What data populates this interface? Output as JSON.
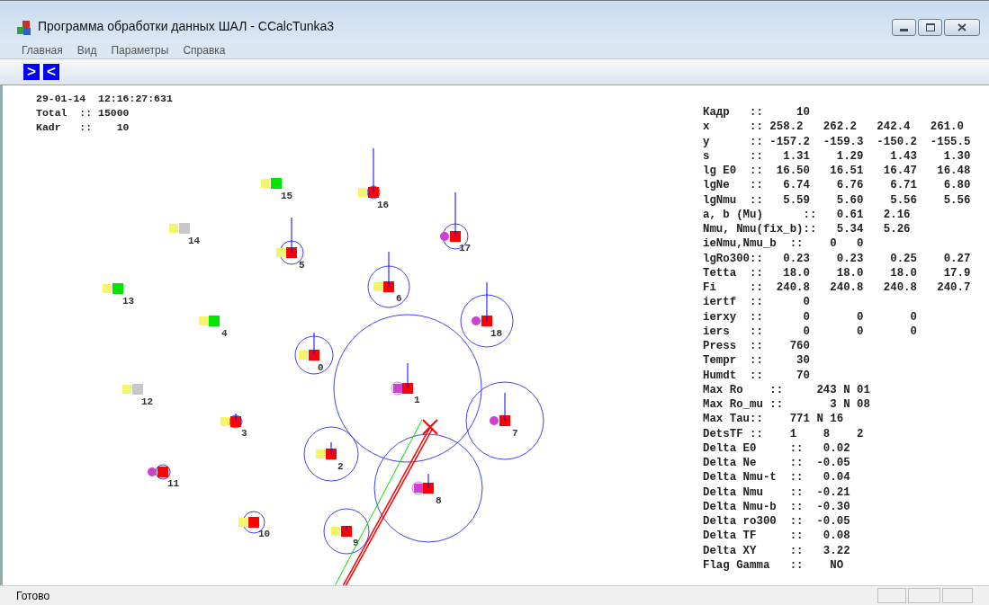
{
  "window": {
    "title": "Программа обработки данных ШАЛ - CCalcTunka3"
  },
  "menu": [
    {
      "label": "Главная"
    },
    {
      "label": "Вид"
    },
    {
      "label": "Параметры"
    },
    {
      "label": "Справка"
    }
  ],
  "toolbar": [
    {
      "label": ">"
    },
    {
      "label": "<"
    }
  ],
  "header_lines": [
    "29-01-14  12:16:27:631",
    "Total  :: 15000",
    "Kadr   ::    10"
  ],
  "detectors": [
    {
      "label": "0",
      "color": "#ff0000",
      "kind": "square"
    },
    {
      "label": "1",
      "color": "#ff0000",
      "kind": "ring"
    },
    {
      "label": "2",
      "color": "#ff0000",
      "kind": "square"
    },
    {
      "label": "3",
      "color": "#ff0000",
      "kind": "square"
    },
    {
      "label": "4",
      "color": "#00e600",
      "kind": "square"
    },
    {
      "label": "5",
      "color": "#ff0000",
      "kind": "square"
    },
    {
      "label": "6",
      "color": "#ff0000",
      "kind": "square"
    },
    {
      "label": "7",
      "color": "#ff0000",
      "kind": "dot"
    },
    {
      "label": "8",
      "color": "#ff0000",
      "kind": "ring"
    },
    {
      "label": "9",
      "color": "#ff0000",
      "kind": "square"
    },
    {
      "label": "10",
      "color": "#ff0000",
      "kind": "square"
    },
    {
      "label": "11",
      "color": "#ff0000",
      "kind": "dot"
    },
    {
      "label": "12",
      "color": "#c8c8c8",
      "kind": "square"
    },
    {
      "label": "13",
      "color": "#00e600",
      "kind": "square"
    },
    {
      "label": "14",
      "color": "#c8c8c8",
      "kind": "square"
    },
    {
      "label": "15",
      "color": "#00e600",
      "kind": "square"
    },
    {
      "label": "16",
      "color": "#ff0000",
      "kind": "square"
    },
    {
      "label": "17",
      "color": "#ff0000",
      "kind": "dot"
    },
    {
      "label": "18",
      "color": "#ff0000",
      "kind": "dot"
    }
  ],
  "readout": [
    "Кадр   ::     10",
    "x      :: 258.2   262.2   242.4   261.0",
    "y      :: -157.2  -159.3  -150.2  -155.5",
    "s      ::   1.31    1.29    1.43    1.30",
    "lg E0  ::  16.50   16.51   16.47   16.48",
    "lgNe   ::   6.74    6.76    6.71    6.80",
    "lgNmu  ::   5.59    5.60    5.56    5.56",
    "a, b (Mu)      ::   0.61   2.16",
    "Nmu, Nmu(fix_b)::   5.34   5.26",
    "ieNmu,Nmu_b  ::    0   0",
    "lgRo300::   0.23    0.23    0.25    0.27",
    "Tetta  ::   18.0    18.0    18.0    17.9",
    "Fi     ::  240.8   240.8   240.8   240.7",
    "iertf  ::      0",
    "ierxy  ::      0       0       0",
    "iers   ::      0       0       0",
    "Press  ::    760",
    "Tempr  ::     30",
    "Humdt  ::     70",
    "Max Ro    ::     243 N 01",
    "Max Ro_mu ::       3 N 08",
    "Max Tau::    771 N 16",
    "DetsTF ::    1    8    2",
    "Delta E0     ::   0.02",
    "Delta Ne     ::  -0.05",
    "Delta Nmu-t  ::   0.04",
    "Delta Nmu    ::  -0.21",
    "Delta Nmu-b  ::  -0.30",
    "Delta ro300  ::  -0.05",
    "Delta TF     ::   0.08",
    "Delta XY     ::   3.22",
    "Flag Gamma   ::    NO"
  ],
  "status_bar": {
    "text": "Готово"
  }
}
